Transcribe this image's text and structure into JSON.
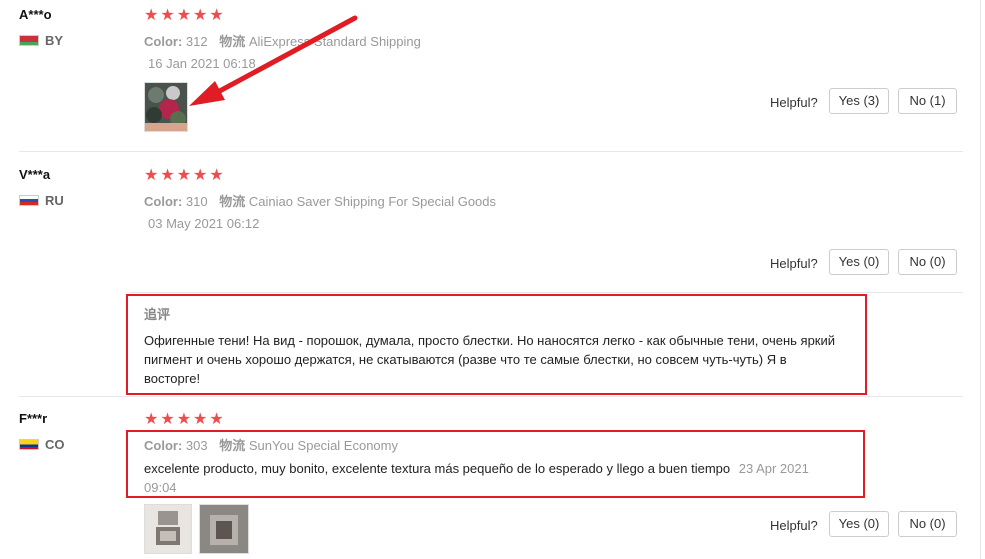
{
  "reviews": [
    {
      "user": "A***o",
      "country": "BY",
      "color_label": "Color:",
      "color_value": "312",
      "shipping_label": "物流",
      "shipping_value": "AliExpress Standard Shipping",
      "date": "16 Jan 2021 06:18",
      "helpful_label": "Helpful?",
      "yes_label": "Yes (3)",
      "no_label": "No (1)"
    },
    {
      "user": "V***a",
      "country": "RU",
      "color_label": "Color:",
      "color_value": "310",
      "shipping_label": "物流",
      "shipping_value": "Cainiao Saver Shipping For Special Goods",
      "date": "03 May 2021 06:12",
      "helpful_label": "Helpful?",
      "yes_label": "Yes (0)",
      "no_label": "No (0)",
      "followup_label": "追评",
      "followup_text": "Офигенные тени! На вид - порошок, думала, просто блестки. Но наносятся легко - как обычные тени, очень яркий пигмент и очень хорошо держатся, не скатываются (разве что те самые блестки, но совсем чуть-чуть) Я в восторге!"
    },
    {
      "user": "F***r",
      "country": "CO",
      "color_label": "Color:",
      "color_value": "303",
      "shipping_label": "物流",
      "shipping_value": "SunYou Special Economy",
      "text": "excelente producto, muy bonito, excelente textura más pequeño de lo esperado y llego a buen tiempo",
      "date_inline": "23 Apr 2021",
      "date_wrap": "09:04",
      "helpful_label": "Helpful?",
      "yes_label": "Yes (0)",
      "no_label": "No (0)"
    }
  ],
  "rating_stars": "★★★★★",
  "colors": {
    "star": "#ef4d4d",
    "highlight_border": "#e01c24",
    "arrow": "#e01c24"
  }
}
